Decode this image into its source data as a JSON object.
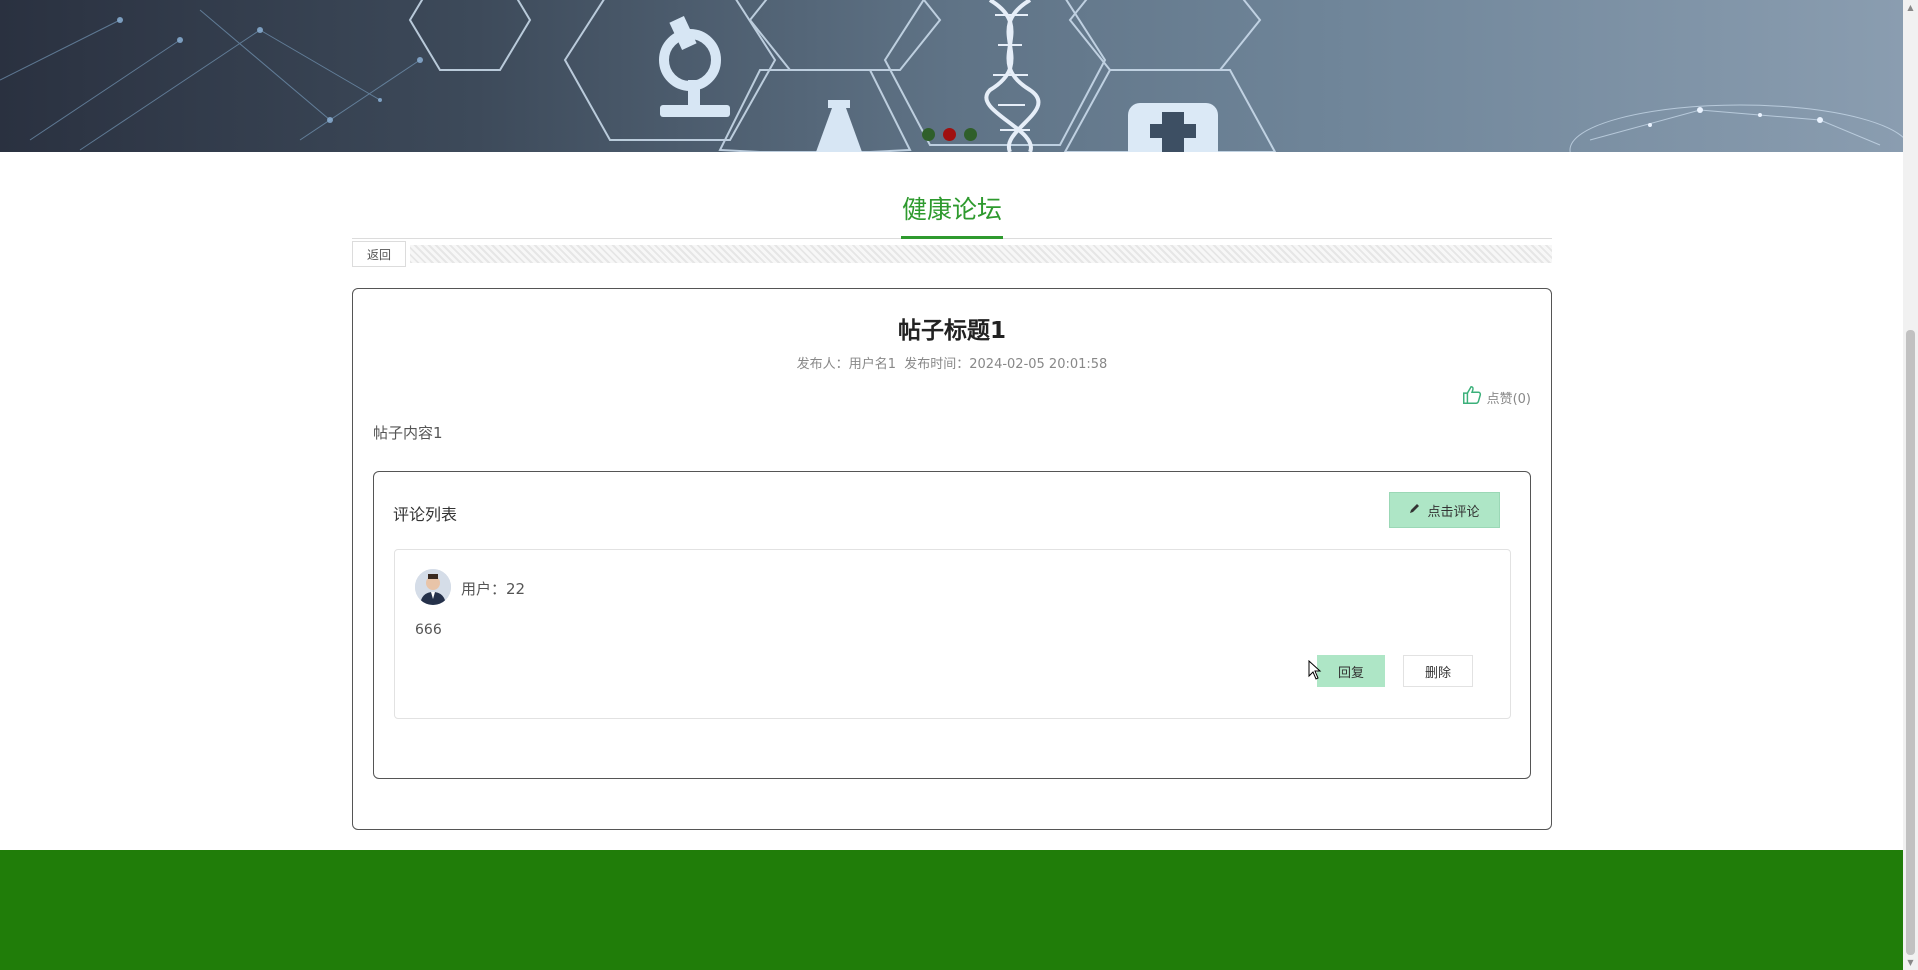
{
  "banner": {
    "carousel_dots": [
      {
        "active": false
      },
      {
        "active": true
      },
      {
        "active": false
      }
    ]
  },
  "section": {
    "title": "健康论坛"
  },
  "toolbar": {
    "back_label": "返回"
  },
  "post": {
    "title": "帖子标题1",
    "publisher_label": "发布人：",
    "publisher": "用户名1",
    "time_label": "发布时间：",
    "time": "2024-02-05 20:01:58",
    "like_label": "点赞(0)",
    "content": "帖子内容1"
  },
  "comments": {
    "title": "评论列表",
    "add_button_label": "点击评论",
    "items": [
      {
        "user": "用户：22",
        "text": "666",
        "reply_label": "回复",
        "delete_label": "删除"
      }
    ]
  },
  "colors": {
    "accent": "#2e9a2e",
    "button_bg": "#aee6c6",
    "footer": "#207d09",
    "active_dot": "#a01010"
  },
  "icons": {
    "like": "thumbs-up-icon",
    "edit": "pencil-icon"
  }
}
